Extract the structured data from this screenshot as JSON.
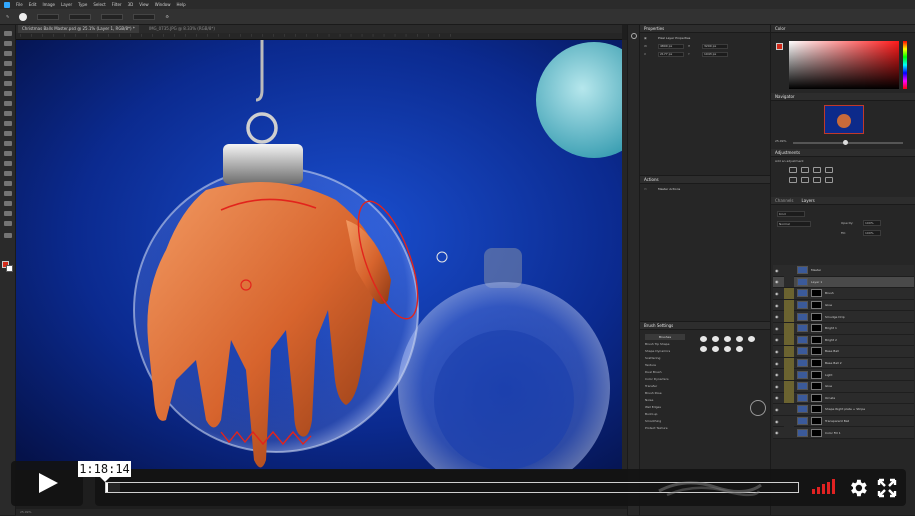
{
  "app": {
    "menu": [
      "File",
      "Edit",
      "Image",
      "Layer",
      "Type",
      "Select",
      "Filter",
      "3D",
      "View",
      "Window",
      "Help"
    ],
    "document_tabs": [
      "Christmas Balls Master.psd @ 25.1% (Layer 1, RGB/8*) *",
      "IMG_0735.JPG @ 8.33% (RGB/8*)"
    ]
  },
  "panels": {
    "properties_title": "Properties",
    "properties_subtitle": "Pixel Layer Properties",
    "properties_fields": [
      {
        "k": "W",
        "v": "4800 px"
      },
      {
        "k": "H",
        "v": "3200 px"
      },
      {
        "k": "X",
        "v": "2177 px"
      },
      {
        "k": "Y",
        "v": "1043 px"
      }
    ],
    "color_title": "Color",
    "navigator_title": "Navigator",
    "navigator_zoom": "25.09%",
    "adjustments_title": "Adjustments",
    "adjustments_hint": "Add an adjustment",
    "actions_title": "Actions",
    "actions_item": "Master Actions",
    "brush_settings_title": "Brush Settings",
    "brushes_button": "Brushes",
    "brush_options": [
      "Brush Tip Shape",
      "Shape Dynamics",
      "Scattering",
      "Texture",
      "Dual Brush",
      "Color Dynamics",
      "Transfer",
      "Brush Pose",
      "Noise",
      "Wet Edges",
      "Build-up",
      "Smoothing",
      "Protect Texture"
    ],
    "layers_tabs": [
      "Channels",
      "Layers"
    ],
    "layers_mode": "Normal",
    "layers_opacity_label": "Opacity:",
    "layers_opacity": "100%",
    "layers_fill_label": "Fill:",
    "layers_fill": "100%",
    "layers": [
      "Master",
      "Layer 1",
      "Brush",
      "Glow",
      "Smudge Drip",
      "Bright 1",
      "Bright 2",
      "Base Ball",
      "Base Ball 2",
      "Light",
      "Glow",
      "Ornate",
      "Shape Right plate + Stripe",
      "Transparent Ball",
      "Color Fill 1"
    ]
  },
  "status": "25.09%",
  "player": {
    "tooltip_time": "1:18:14",
    "played_fraction": 0.003,
    "buffered_fraction": 0.02,
    "volume_level": 0.8
  }
}
